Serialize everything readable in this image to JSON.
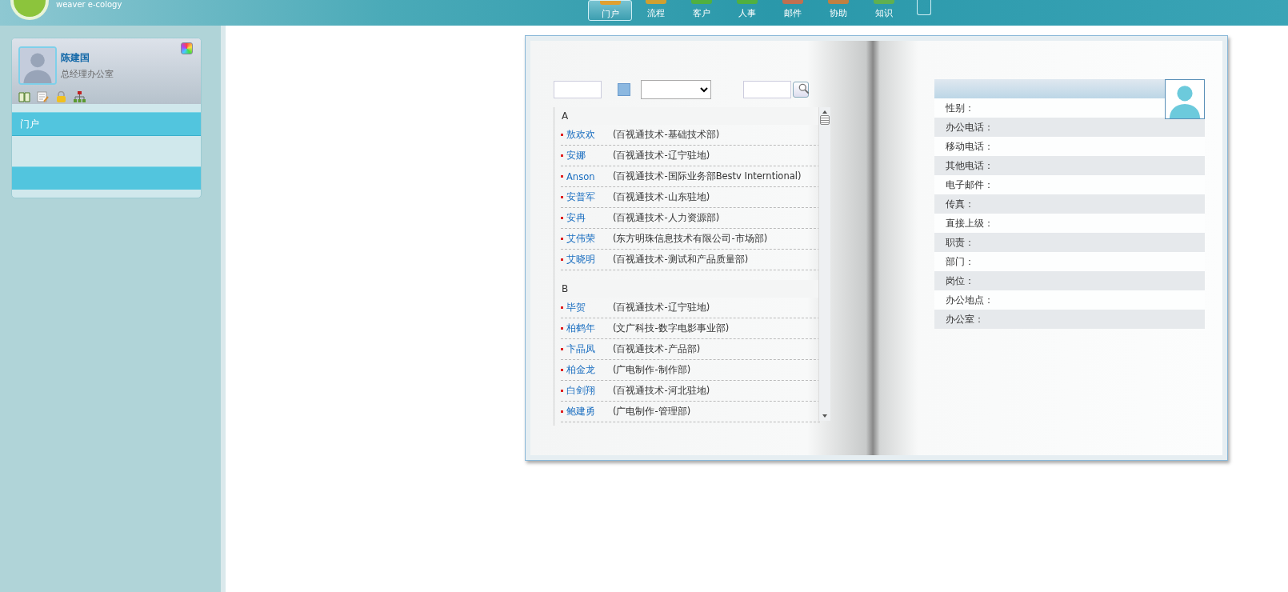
{
  "header": {
    "brand": "weaver e-cology"
  },
  "nav": [
    {
      "label": "门户",
      "selected": true,
      "color": "#e0a030"
    },
    {
      "label": "流程",
      "selected": false,
      "color": "#d0a030"
    },
    {
      "label": "客户",
      "selected": false,
      "color": "#50b040"
    },
    {
      "label": "人事",
      "selected": false,
      "color": "#50b040"
    },
    {
      "label": "邮件",
      "selected": false,
      "color": "#c07050"
    },
    {
      "label": "协助",
      "selected": false,
      "color": "#c08040"
    },
    {
      "label": "知识",
      "selected": false,
      "color": "#60b050"
    }
  ],
  "profile": {
    "name": "陈建国",
    "department": "总经理办公室"
  },
  "menu": [
    {
      "label": "门户",
      "selected": true
    }
  ],
  "directory": {
    "groups": [
      {
        "letter": "A",
        "people": [
          {
            "name": "敖欢欢",
            "dept": "(百视通技术-基础技术部)"
          },
          {
            "name": "安娜",
            "dept": "(百视通技术-辽宁驻地)"
          },
          {
            "name": "Anson",
            "dept": "(百视通技术-国际业务部Bestv Interntional)"
          },
          {
            "name": "安普军",
            "dept": "(百视通技术-山东驻地)"
          },
          {
            "name": "安冉",
            "dept": "(百视通技术-人力资源部)"
          },
          {
            "name": "艾伟荣",
            "dept": "(东方明珠信息技术有限公司-市场部)"
          },
          {
            "name": "艾晓明",
            "dept": "(百视通技术-测试和产品质量部)"
          }
        ]
      },
      {
        "letter": "B",
        "people": [
          {
            "name": "毕贺",
            "dept": "(百视通技术-辽宁驻地)"
          },
          {
            "name": "柏鹤年",
            "dept": "(文广科技-数字电影事业部)"
          },
          {
            "name": "卞晶凤",
            "dept": "(百视通技术-产品部)"
          },
          {
            "name": "柏金龙",
            "dept": "(广电制作-制作部)"
          },
          {
            "name": "白剑翔",
            "dept": "(百视通技术-河北驻地)"
          },
          {
            "name": "鲍建勇",
            "dept": "(广电制作-管理部)"
          }
        ]
      }
    ]
  },
  "details": {
    "fields": [
      "性别：",
      "办公电话：",
      "移动电话：",
      "其他电话：",
      "电子邮件：",
      "传真：",
      "直接上级：",
      "职责：",
      "部门：",
      "岗位：",
      "办公地点：",
      "办公室："
    ]
  }
}
